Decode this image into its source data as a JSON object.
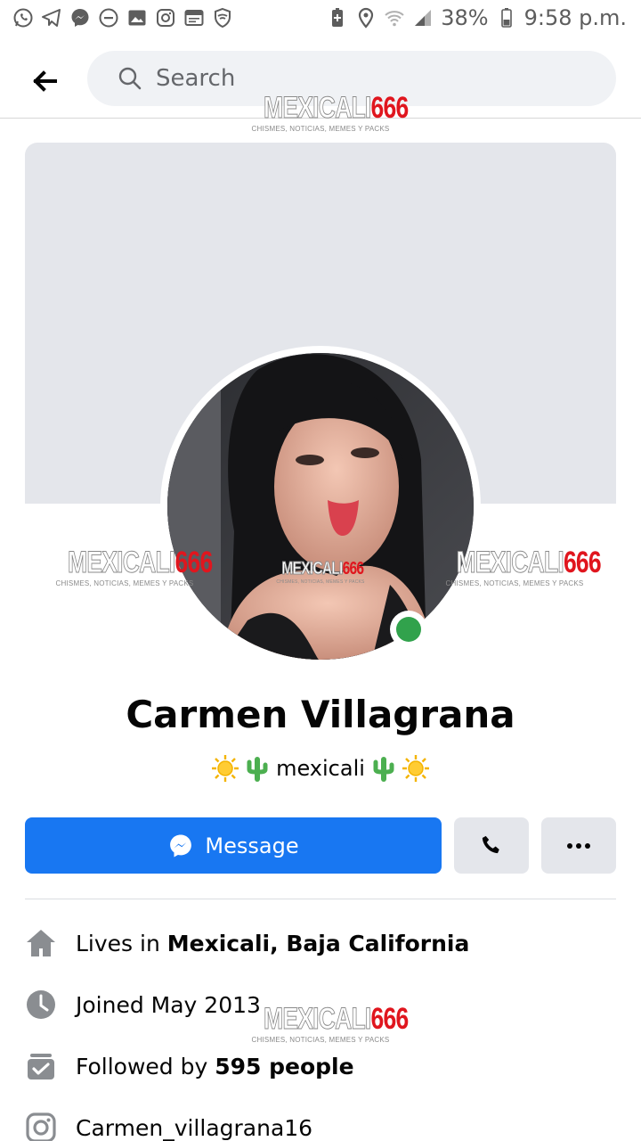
{
  "status_bar": {
    "battery": "38%",
    "time": "9:58 p.m.",
    "left_icons": [
      "whatsapp-icon",
      "telegram-icon",
      "messenger-icon",
      "do-not-disturb-icon",
      "gallery-icon",
      "instagram-icon",
      "calendar-icon",
      "vpn-shield-icon"
    ],
    "right_icons": [
      "battery-saver-icon",
      "location-icon",
      "wifi-icon",
      "signal-icon",
      "battery-icon"
    ]
  },
  "header": {
    "search_placeholder": "Search"
  },
  "watermark": {
    "brand_part1": "MEXICALI",
    "brand_part2": "666",
    "tagline": "CHISMES, NOTICIAS, MEMES Y PACKS"
  },
  "profile": {
    "name": "Carmen Villagrana",
    "bio_text": "mexicali",
    "online": true
  },
  "actions": {
    "message_label": "Message"
  },
  "info": {
    "lives_prefix": "Lives in ",
    "lives_value": "Mexicali, Baja California",
    "joined": "Joined May 2013",
    "followed_prefix": "Followed by ",
    "followed_value": "595 people",
    "instagram": "Carmen_villagrana16"
  },
  "colors": {
    "accent": "#1877f2",
    "online": "#31a24c",
    "cover": "#e4e6eb"
  }
}
